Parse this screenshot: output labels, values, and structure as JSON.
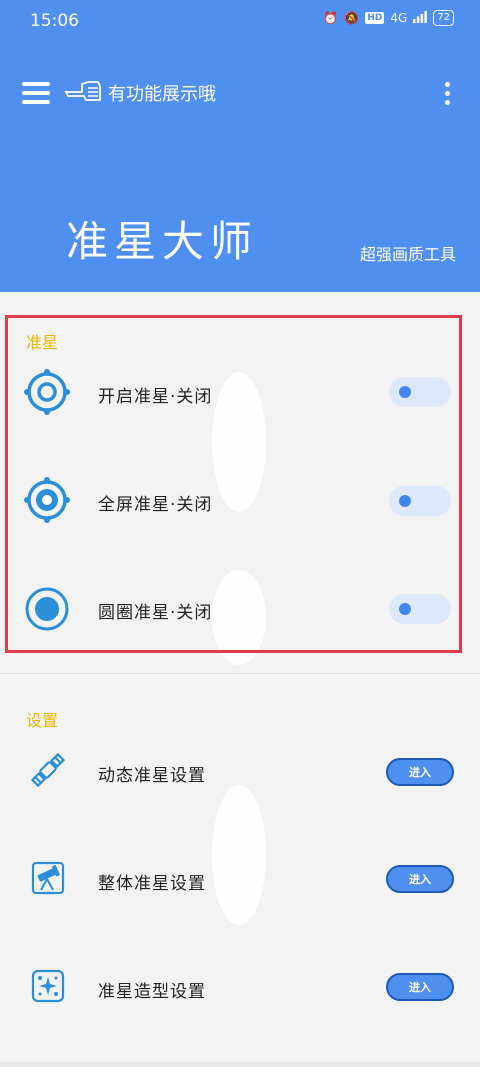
{
  "status_bar": {
    "time": "15:06",
    "hd": "HD",
    "network": "4G",
    "battery": "72"
  },
  "toolbar": {
    "title": "有功能展示哦"
  },
  "hero": {
    "title": "准星大师",
    "subtitle": "超强画质工具"
  },
  "section_crosshair": {
    "label": "准星",
    "items": [
      {
        "label": "开启准星·关闭",
        "icon": "crosshair-ring-icon"
      },
      {
        "label": "全屏准星·关闭",
        "icon": "crosshair-dot-icon"
      },
      {
        "label": "圆圈准星·关闭",
        "icon": "circle-dot-icon"
      }
    ]
  },
  "section_settings": {
    "label": "设置",
    "items": [
      {
        "label": "动态准星设置",
        "button": "进入",
        "icon": "satellite-icon"
      },
      {
        "label": "整体准星设置",
        "button": "进入",
        "icon": "telescope-icon"
      },
      {
        "label": "准星造型设置",
        "button": "进入",
        "icon": "sparkle-icon"
      }
    ]
  },
  "colors": {
    "header": "#4f8ff0",
    "accent_gold": "#e8b800",
    "highlight_red": "#e03a4a",
    "icon_blue": "#2a8fd6"
  }
}
